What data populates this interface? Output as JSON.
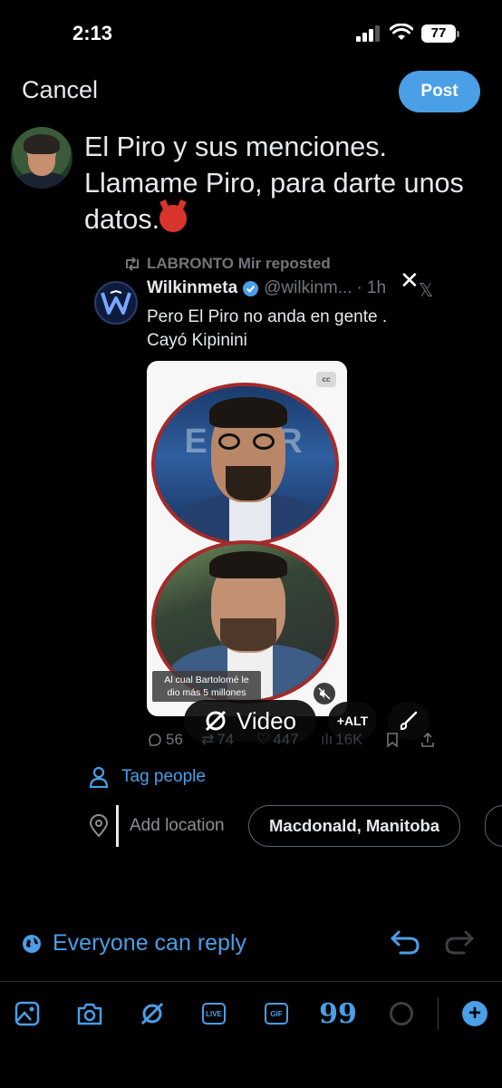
{
  "status_bar": {
    "time": "2:13",
    "battery": "77"
  },
  "header": {
    "cancel_label": "Cancel",
    "post_label": "Post"
  },
  "compose": {
    "text_line1": "El Piro y sus menciones.",
    "text_line2": "Llamame Piro, para darte unos",
    "text_line3": "datos.",
    "emoji": "ogre-emoji"
  },
  "quote": {
    "repost_label": "LABRONTO Mir reposted",
    "author_name": "Wilkinmeta",
    "author_handle": "@wilkinm...",
    "separator": "·",
    "time": "1h",
    "text_line1": "Pero El Piro no anda en gente .",
    "text_line2": "Cayó Kipinini",
    "media_bg_text": "ES ER",
    "cc_badge": "cc",
    "caption": "Al cual Bartolomé le dio más 5 millones",
    "stats": {
      "replies": "56",
      "reposts": "74",
      "likes": "447",
      "views": "16K"
    }
  },
  "media_actions": {
    "video_label": "Video",
    "alt_label": "+ALT"
  },
  "tag_people_label": "Tag people",
  "add_location_label": "Add location",
  "location_suggestions": [
    "Macdonald, Manitoba"
  ],
  "reply_setting_label": "Everyone can reply",
  "toolbar": {
    "live_label": "LIVE",
    "gif_label": "GIF",
    "add_label": "+"
  },
  "colors": {
    "accent": "#4a9fe6",
    "background": "#000000",
    "muted": "#71767b",
    "text": "#e7e9ea"
  }
}
